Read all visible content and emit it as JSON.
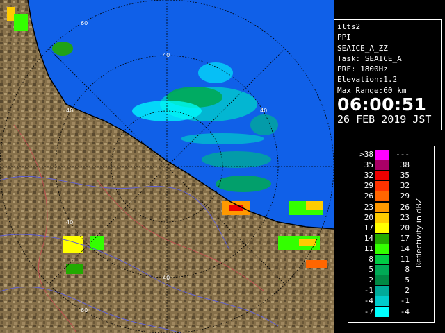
{
  "info": {
    "station": "ilts2",
    "scan_type": "PPI",
    "product": "SEAICE_A_ZZ",
    "task": "Task: SEAICE_A",
    "prf": "PRF: 1800Hz",
    "elevation": "Elevation:1.2",
    "max_range": "Max Range:60 km",
    "time": "06:00:51",
    "date": "26 FEB 2019 JST"
  },
  "legend": {
    "unit_label": "Reflectivity in dBZ",
    "rows": [
      {
        "lo": ">38",
        "hi": "---",
        "color": "#ff00ff"
      },
      {
        "lo": "35",
        "hi": "38",
        "color": "#aa0066"
      },
      {
        "lo": "32",
        "hi": "35",
        "color": "#ee0000"
      },
      {
        "lo": "29",
        "hi": "32",
        "color": "#ff3300"
      },
      {
        "lo": "26",
        "hi": "29",
        "color": "#ff6600"
      },
      {
        "lo": "23",
        "hi": "26",
        "color": "#ff9900"
      },
      {
        "lo": "20",
        "hi": "23",
        "color": "#ffcc00"
      },
      {
        "lo": "17",
        "hi": "20",
        "color": "#ffff00"
      },
      {
        "lo": "14",
        "hi": "17",
        "color": "#22aa00"
      },
      {
        "lo": "11",
        "hi": "14",
        "color": "#33ff00"
      },
      {
        "lo": "8",
        "hi": "11",
        "color": "#00cc44"
      },
      {
        "lo": "5",
        "hi": "8",
        "color": "#00aa55"
      },
      {
        "lo": "2",
        "hi": "5",
        "color": "#008844"
      },
      {
        "lo": "-1",
        "hi": "2",
        "color": "#00aa99"
      },
      {
        "lo": "-4",
        "hi": "-1",
        "color": "#00cccc"
      },
      {
        "lo": "-7",
        "hi": "-4",
        "color": "#00ffff"
      }
    ]
  },
  "map": {
    "range_labels": [
      "60",
      "40",
      "40",
      "40",
      "40",
      "40",
      "60"
    ],
    "sea_color": "#1060e8",
    "land_color": "#8a7048"
  }
}
